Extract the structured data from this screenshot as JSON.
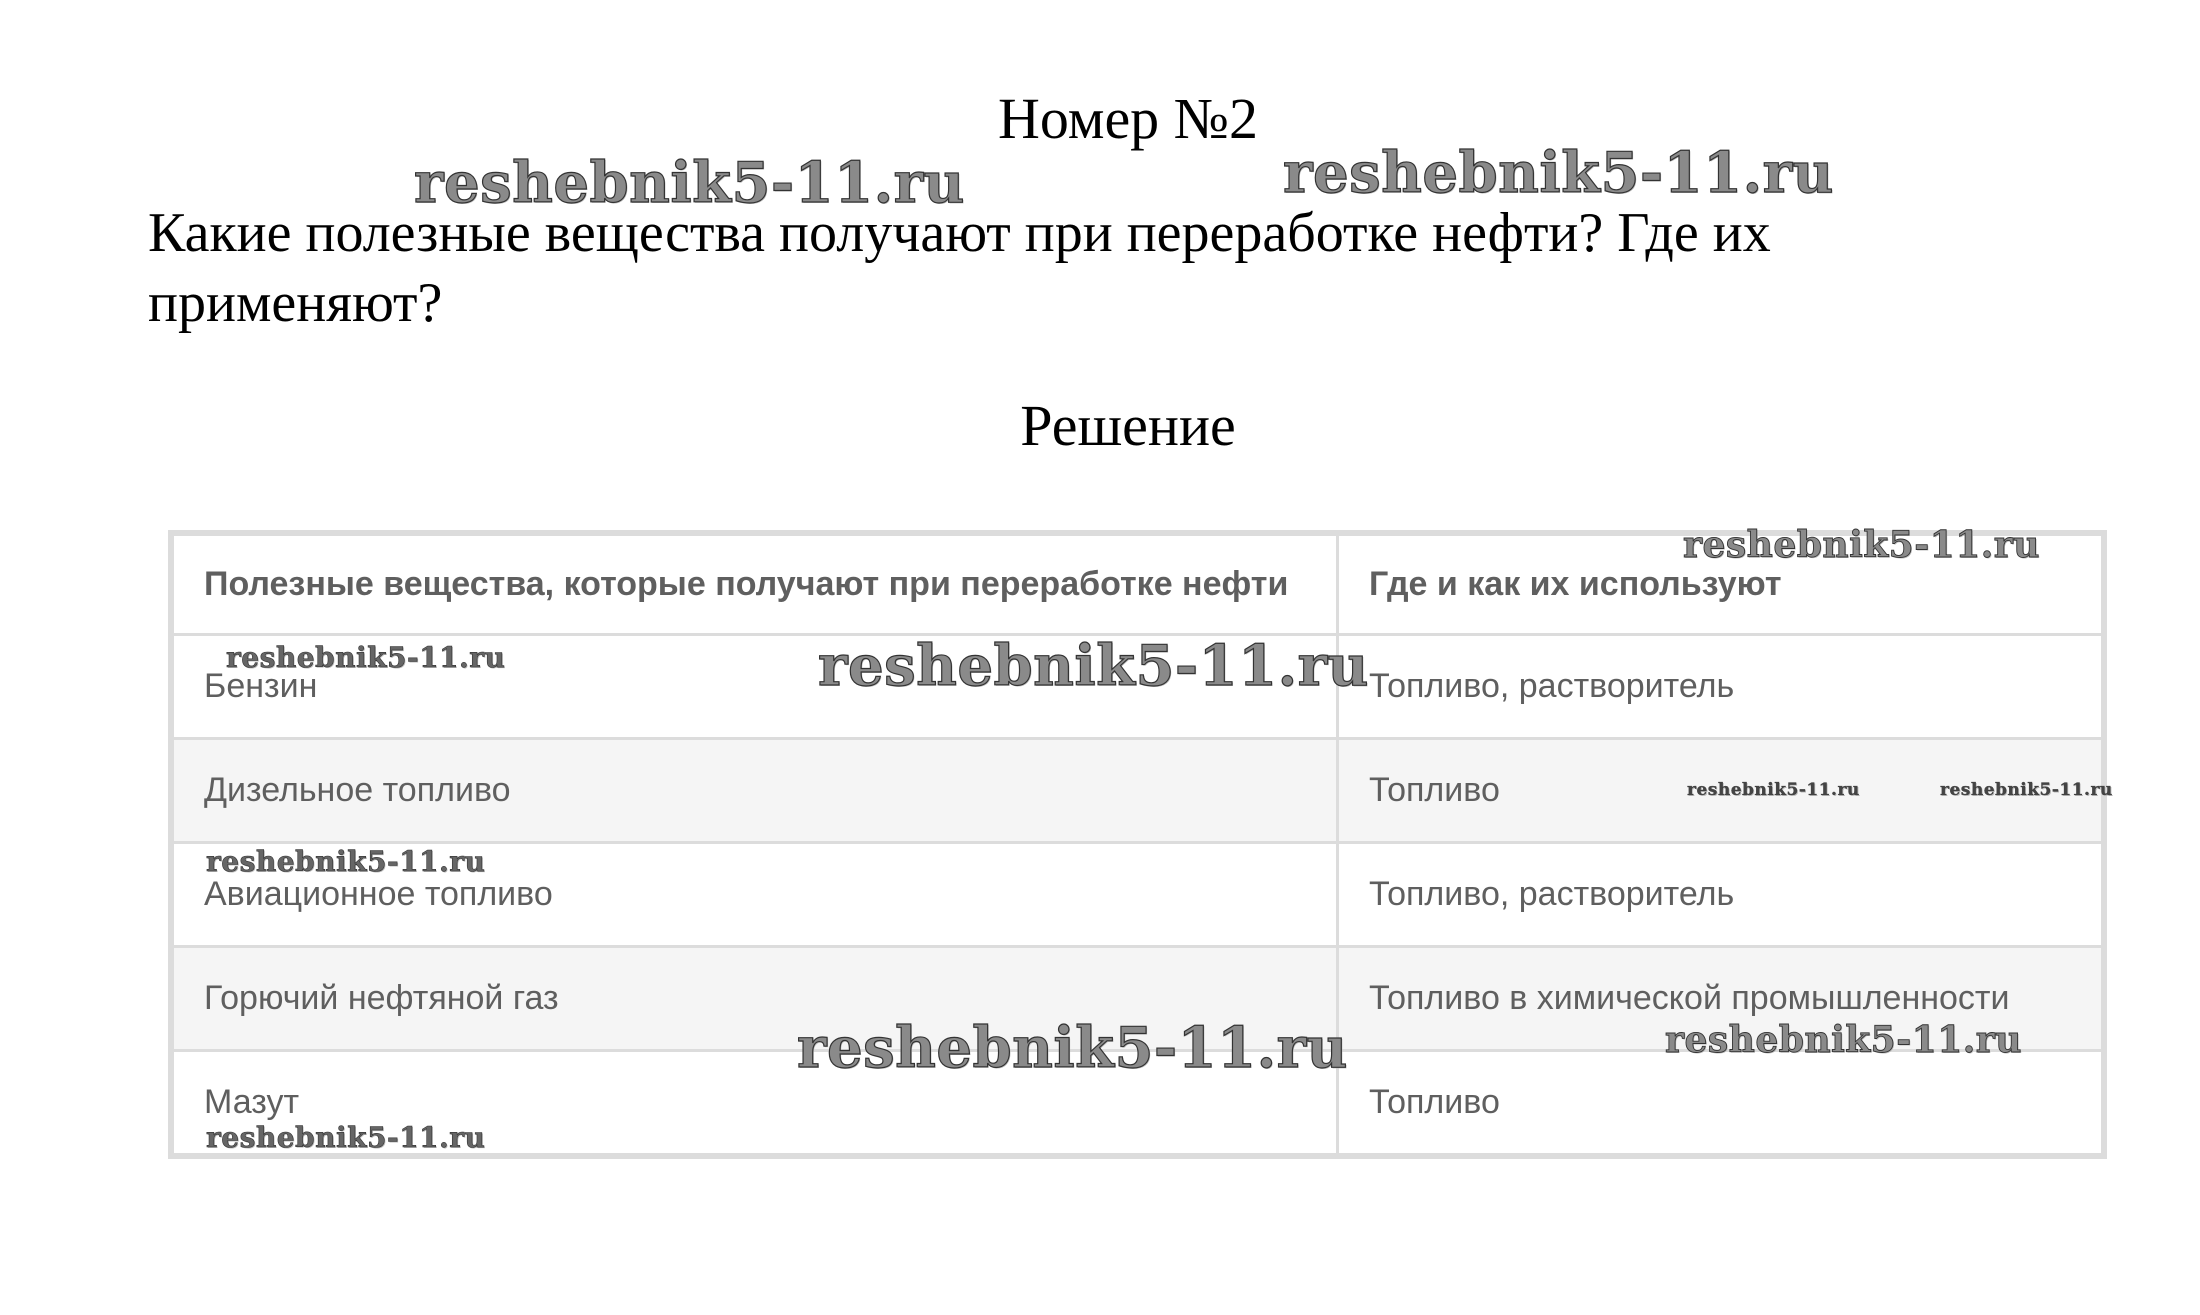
{
  "title": "Номер №2",
  "question": "Какие полезные вещества получают при переработке нефти? Где их применяют?",
  "solution_heading": "Решение",
  "table": {
    "headers": [
      "Полезные вещества, которые получают при переработке нефти",
      "Где и как их используют"
    ],
    "rows": [
      [
        "Бензин",
        "Топливо, растворитель"
      ],
      [
        "Дизельное топливо",
        "Топливо"
      ],
      [
        "Авиационное топливо",
        "Топливо, растворитель"
      ],
      [
        "Горючий нефтяной газ",
        "Топливо в химической промышленности"
      ],
      [
        "Мазут",
        "Топливо"
      ]
    ]
  },
  "watermark": "reshebnik5-11.ru"
}
